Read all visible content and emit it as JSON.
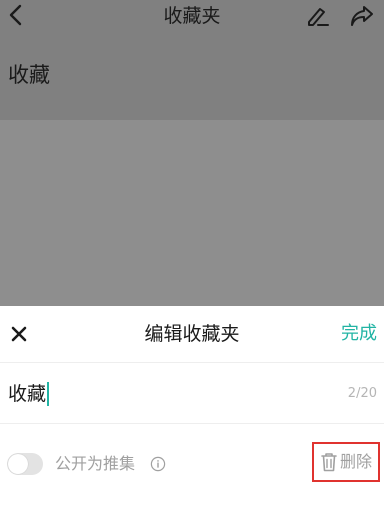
{
  "background_page": {
    "title": "收藏夹",
    "heading": "收藏",
    "icons": [
      "back-icon",
      "edit-icon",
      "share-icon"
    ]
  },
  "sheet": {
    "title": "编辑收藏夹",
    "close_icon": "close-icon",
    "done_label": "完成",
    "accent_color": "#22b4a4",
    "name_input": {
      "value": "收藏",
      "counter": "2/20"
    },
    "public_toggle": {
      "label": "公开为推集",
      "state": "off",
      "info_icon": "info-icon"
    },
    "delete": {
      "label": "删除",
      "icon": "trash-icon",
      "highlight_color": "#e0332f"
    }
  }
}
